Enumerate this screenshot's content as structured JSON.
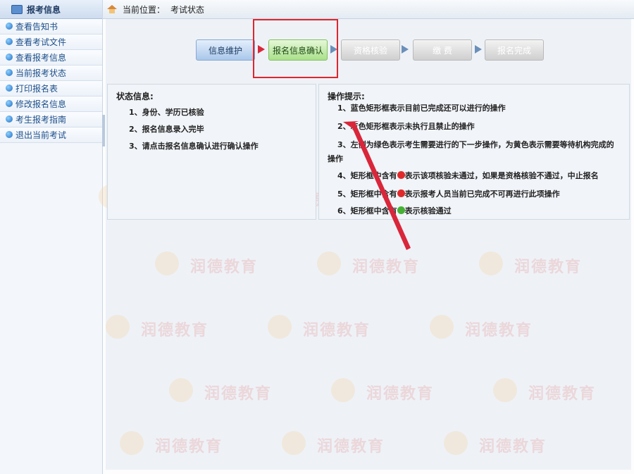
{
  "sidebar": {
    "title": "报考信息",
    "items": [
      {
        "label": "查看告知书"
      },
      {
        "label": "查看考试文件"
      },
      {
        "label": "查看报考信息"
      },
      {
        "label": "当前报考状态"
      },
      {
        "label": "打印报名表"
      },
      {
        "label": "修改报名信息"
      },
      {
        "label": "考生报考指南"
      },
      {
        "label": "退出当前考试"
      }
    ]
  },
  "breadcrumb": {
    "label": "当前位置：",
    "current": "考试状态"
  },
  "steps": [
    {
      "label": "信息维护",
      "state": "blue"
    },
    {
      "label": "报名信息确认",
      "state": "green"
    },
    {
      "label": "资格核验",
      "state": "gray"
    },
    {
      "label": "缴 费",
      "state": "gray"
    },
    {
      "label": "报名完成",
      "state": "gray"
    }
  ],
  "status_panel": {
    "title": "状态信息:",
    "lines": [
      "1、身份、学历已核验",
      "2、报名信息录入完毕",
      "3、请点击报名信息确认进行确认操作"
    ]
  },
  "tips_panel": {
    "title": "操作提示:",
    "line1": "1、蓝色矩形框表示目前已完成还可以进行的操作",
    "line2": "2、灰色矩形框表示未执行且禁止的操作",
    "line3a": "3、左侧为绿色表示考生需要进行的下一步操作，为黄色表示需要等待机构完成的",
    "line3b": "操作",
    "line4a": "4、矩形框中含有",
    "line4b": "表示该项核验未通过，如果是资格核验不通过，中止报名",
    "line5a": "5、矩形框中含有",
    "line5b": "表示报考人员当前已完成不可再进行此项操作",
    "line6a": "6、矩形框中含有",
    "line6b": "表示核验通过"
  },
  "watermark": {
    "text": "润德教育"
  },
  "colors": {
    "highlight": "#e0252b",
    "annotation_arrow": "#d9263a"
  }
}
